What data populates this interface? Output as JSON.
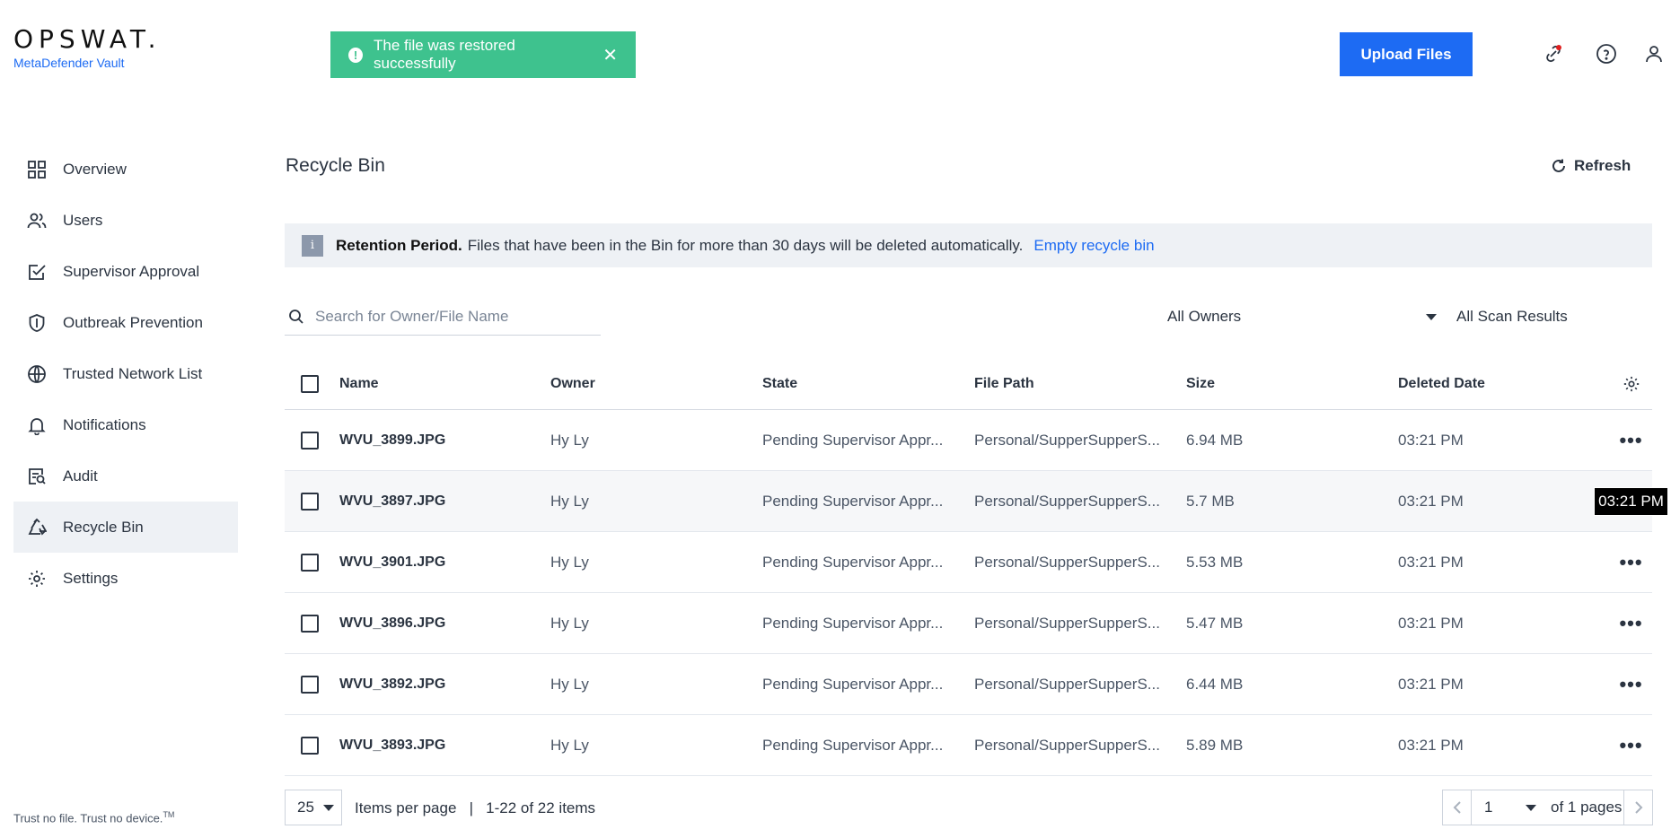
{
  "brand": {
    "name": "OPSWAT.",
    "product": "MetaDefender Vault"
  },
  "toast": {
    "message": "The file was restored successfully"
  },
  "header": {
    "upload_label": "Upload Files"
  },
  "sidebar": {
    "items": [
      {
        "label": "Overview",
        "icon": "grid-icon"
      },
      {
        "label": "Users",
        "icon": "users-icon"
      },
      {
        "label": "Supervisor Approval",
        "icon": "approval-icon"
      },
      {
        "label": "Outbreak Prevention",
        "icon": "shield-icon"
      },
      {
        "label": "Trusted Network List",
        "icon": "globe-icon"
      },
      {
        "label": "Notifications",
        "icon": "bell-icon"
      },
      {
        "label": "Audit",
        "icon": "audit-icon"
      },
      {
        "label": "Recycle Bin",
        "icon": "recycle-icon",
        "active": true
      },
      {
        "label": "Settings",
        "icon": "gear-icon"
      }
    ],
    "footer": "Trust no file. Trust no device.",
    "footer_tm": "TM"
  },
  "page": {
    "title": "Recycle Bin",
    "refresh_label": "Refresh"
  },
  "banner": {
    "title": "Retention Period.",
    "message": "Files that have been in the Bin for more than 30 days will be deleted automatically.",
    "link": "Empty recycle bin"
  },
  "filters": {
    "search_placeholder": "Search for Owner/File Name",
    "owner_filter": "All Owners",
    "scan_filter": "All Scan Results"
  },
  "table": {
    "columns": [
      "Name",
      "Owner",
      "State",
      "File Path",
      "Size",
      "Deleted Date"
    ],
    "rows": [
      {
        "name": "WVU_3899.JPG",
        "owner": "Hy Ly",
        "state": "Pending Supervisor Appr...",
        "path": "Personal/SupperSupperS...",
        "size": "6.94 MB",
        "date": "03:21 PM"
      },
      {
        "name": "WVU_3897.JPG",
        "owner": "Hy Ly",
        "state": "Pending Supervisor Appr...",
        "path": "Personal/SupperSupperS...",
        "size": "5.7 MB",
        "date": "03:21 PM",
        "tooltip": "03:21 PM"
      },
      {
        "name": "WVU_3901.JPG",
        "owner": "Hy Ly",
        "state": "Pending Supervisor Appr...",
        "path": "Personal/SupperSupperS...",
        "size": "5.53 MB",
        "date": "03:21 PM"
      },
      {
        "name": "WVU_3896.JPG",
        "owner": "Hy Ly",
        "state": "Pending Supervisor Appr...",
        "path": "Personal/SupperSupperS...",
        "size": "5.47 MB",
        "date": "03:21 PM"
      },
      {
        "name": "WVU_3892.JPG",
        "owner": "Hy Ly",
        "state": "Pending Supervisor Appr...",
        "path": "Personal/SupperSupperS...",
        "size": "6.44 MB",
        "date": "03:21 PM"
      },
      {
        "name": "WVU_3893.JPG",
        "owner": "Hy Ly",
        "state": "Pending Supervisor Appr...",
        "path": "Personal/SupperSupperS...",
        "size": "5.89 MB",
        "date": "03:21 PM"
      }
    ]
  },
  "pagination": {
    "page_size": "25",
    "summary": "Items per page   |   1-22 of 22 items",
    "current_page": "1",
    "of_pages": "of 1 pages"
  },
  "colors": {
    "accent": "#1d6bf3",
    "toast": "#3ec28e",
    "notify_dot": "#e02020"
  }
}
